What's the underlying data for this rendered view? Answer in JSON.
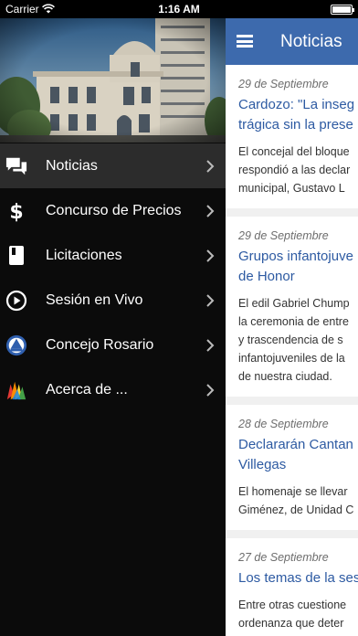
{
  "status_bar": {
    "carrier": "Carrier",
    "time": "1:16 AM"
  },
  "header": {
    "title": "Noticias"
  },
  "menu": {
    "items": [
      {
        "label": "Noticias",
        "icon": "chat-bubbles-icon",
        "active": true
      },
      {
        "label": "Concurso de Precios",
        "icon": "dollar-icon",
        "active": false
      },
      {
        "label": "Licitaciones",
        "icon": "book-icon",
        "active": false
      },
      {
        "label": "Sesión en Vivo",
        "icon": "play-circle-icon",
        "active": false
      },
      {
        "label": "Concejo Rosario",
        "icon": "concejo-logo-icon",
        "active": false
      },
      {
        "label": "Acerca de ...",
        "icon": "info-colorful-icon",
        "active": false
      }
    ]
  },
  "news": [
    {
      "date": "29 de Septiembre",
      "headline": [
        "Cardozo: \"La inseg",
        "trágica sin la prese"
      ],
      "summary": [
        "El concejal del bloque",
        "respondió a las declar",
        "municipal, Gustavo  L"
      ]
    },
    {
      "date": "29 de Septiembre",
      "headline": [
        "Grupos infantojuve",
        "de Honor"
      ],
      "summary": [
        "El edil Gabriel Chump",
        "la ceremonia de entre",
        "y trascendencia  de  s",
        "infantojuveniles de la",
        "de nuestra ciudad."
      ]
    },
    {
      "date": "28 de Septiembre",
      "headline": [
        "Declararán Cantan",
        "Villegas"
      ],
      "summary": [
        "El homenaje se llevar",
        "Giménez, de Unidad C"
      ]
    },
    {
      "date": "27 de Septiembre",
      "headline": [
        "Los temas de la ses"
      ],
      "summary": [
        "Entre otras cuestione",
        "ordenanza que deter"
      ]
    }
  ],
  "colors": {
    "accent": "#3d6aad",
    "link": "#2d5aa2",
    "menu_bg": "#0b0b0b",
    "menu_active": "#2c2c2c"
  }
}
